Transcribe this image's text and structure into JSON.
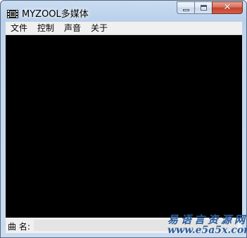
{
  "window": {
    "title": "MYZOOL多媒体",
    "icon": "film-icon",
    "controls": {
      "minimize": "minimize-icon",
      "maximize": "maximize-icon",
      "close_glyph": "✕"
    }
  },
  "menu": {
    "items": [
      {
        "label": "文件"
      },
      {
        "label": "控制"
      },
      {
        "label": "声音"
      },
      {
        "label": "关于"
      }
    ]
  },
  "status": {
    "song_label": "曲  名:",
    "song_value": ""
  },
  "watermark": {
    "text_cn": "易语言资源网",
    "text_url": "www.e5a5x.com"
  },
  "colors": {
    "video_background": "#000000",
    "close_button": "#c6432f",
    "watermark": "#2a5d9a"
  }
}
